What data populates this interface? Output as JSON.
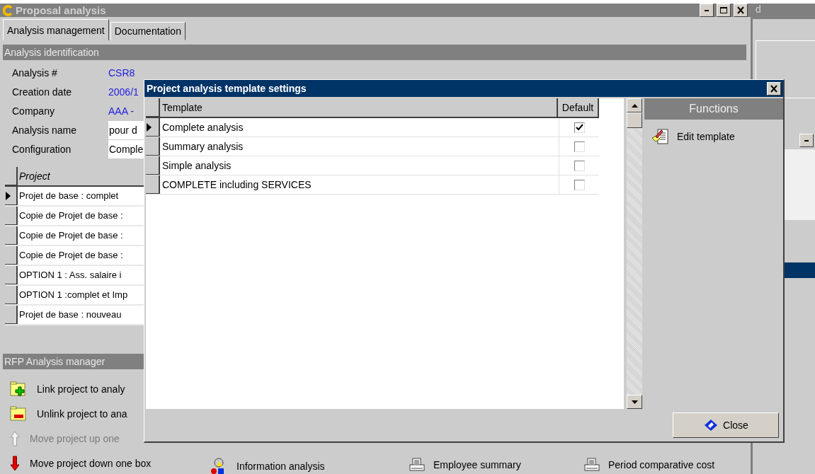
{
  "back_window": {
    "title": "d"
  },
  "window": {
    "title": "Proposal analysis"
  },
  "tabs": [
    {
      "label": "Analysis management",
      "selected": true
    },
    {
      "label": "Documentation",
      "selected": false
    }
  ],
  "identification": {
    "header": "Analysis identification",
    "fields": [
      {
        "label": "Analysis #",
        "value": "CSR8",
        "kind": "link"
      },
      {
        "label": "Creation date",
        "value": "2006/1",
        "kind": "link"
      },
      {
        "label": "Company",
        "value": "AAA -",
        "kind": "link"
      },
      {
        "label": "Analysis name",
        "value": "pour d",
        "kind": "input"
      },
      {
        "label": "Configuration",
        "value": "Comple",
        "kind": "input"
      }
    ]
  },
  "projects": {
    "columns": [
      "Project"
    ],
    "rows": [
      {
        "cells": [
          "Projet de base : complet"
        ],
        "selected": true
      },
      {
        "cells": [
          "Copie de Projet de base :"
        ],
        "selected": false
      },
      {
        "cells": [
          "Copie de Projet de base :"
        ],
        "selected": false
      },
      {
        "cells": [
          "Copie de Projet de base :"
        ],
        "selected": false
      },
      {
        "cells": [
          "OPTION 1 : Ass. salaire i"
        ],
        "selected": false
      },
      {
        "cells": [
          "OPTION 1 :complet et Imp"
        ],
        "selected": false
      },
      {
        "cells": [
          "Projet de base : nouveau"
        ],
        "selected": false
      }
    ]
  },
  "manager": {
    "header": "RFP Analysis manager",
    "actions": [
      {
        "label": "Link project to analy",
        "kind": "link",
        "disabled": false
      },
      {
        "label": "Unlink project to ana",
        "kind": "unlink",
        "disabled": false
      },
      {
        "label": "Move project up one",
        "kind": "up",
        "disabled": true
      },
      {
        "label": "Move project down one box",
        "kind": "down",
        "disabled": false
      }
    ],
    "reports": [
      {
        "label": "Information analysis",
        "kind": "info"
      },
      {
        "label": "Employee summary",
        "kind": "print"
      },
      {
        "label": "Period comparative cost",
        "kind": "print"
      }
    ]
  },
  "dialog": {
    "title": "Project analysis template settings",
    "columns": [
      "Template",
      "Default"
    ],
    "rows": [
      {
        "template": "Complete analysis",
        "default": true,
        "selected": true
      },
      {
        "template": "Summary analysis",
        "default": false,
        "selected": false
      },
      {
        "template": "Simple analysis",
        "default": false,
        "selected": false
      },
      {
        "template": "COMPLETE including SERVICES",
        "default": false,
        "selected": false
      }
    ],
    "functions": {
      "header": "Functions",
      "items": [
        {
          "label": "Edit template",
          "kind": "edit"
        }
      ]
    },
    "close_label": "Close"
  }
}
